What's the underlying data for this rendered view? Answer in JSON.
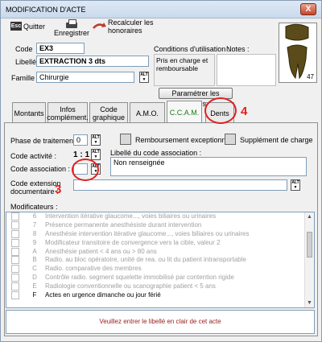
{
  "window": {
    "title": "MODIFICATION D'ACTE",
    "close_glyph": "X"
  },
  "toolbar": {
    "quit_label": "Quitter",
    "quit_icon_text": "Esc",
    "save_label": "Enregistrer",
    "recalc_label": "Recalculer les honoraires"
  },
  "form": {
    "code_label": "Code",
    "code_value": "EX3",
    "libelle_label": "Libellé",
    "libelle_value": "EXTRACTION 3 dts",
    "famille_label": "Famille",
    "famille_value": "Chirurgie",
    "conditions_label": "Conditions d'utilisation :",
    "notes_label": "Notes :",
    "conditions_value": "Pris en charge et remboursable",
    "parametrer_label": "Paramétrer les Familles...",
    "tooth_number": "47"
  },
  "tabs": [
    {
      "label": "Montants"
    },
    {
      "label": "Infos complément."
    },
    {
      "label": "Code graphique"
    },
    {
      "label": "A.M.O."
    },
    {
      "label": "C.C.A.M."
    },
    {
      "label": "Dents"
    }
  ],
  "ccam": {
    "phase_label": "Phase de traitement :",
    "phase_value": "0",
    "remb_label": "Remboursement exceptionnel",
    "supp_label": "Supplément de charge",
    "code_activite_label": "Code activité :",
    "code_activite_value": "1 : 1",
    "code_association_label": "Code association :",
    "libelle_assoc_label": "Libellé du code association :",
    "libelle_assoc_value": "Non renseignée",
    "code_extension_label": "Code extension documentaire :",
    "modificateurs_label": "Modificateurs :",
    "alt_text": "ALT"
  },
  "modificateurs": [
    {
      "code": "6",
      "desc": "Intervention itérative glaucome..., voies biliaires ou urinaires",
      "active": false
    },
    {
      "code": "7",
      "desc": "Présence permanente anesthésiste durant intervention",
      "active": false
    },
    {
      "code": "8",
      "desc": "Anesthésie intervention itérative glaucome..., voies biliaires ou urinaires",
      "active": false
    },
    {
      "code": "9",
      "desc": "Modificateur transitoire de convergence vers la cible, valeur 2",
      "active": false
    },
    {
      "code": "A",
      "desc": "Anesthésie patient < 4 ans ou > 80 ans",
      "active": false
    },
    {
      "code": "B",
      "desc": "Radio. au bloc opératoire, unité de rea. ou lit du patient intransportable",
      "active": false
    },
    {
      "code": "C",
      "desc": "Radio. comparative des membres",
      "active": false
    },
    {
      "code": "D",
      "desc": "Contrôle radio. segment squelette immobilisé par contention rigide",
      "active": false
    },
    {
      "code": "E",
      "desc": "Radiologie conventionnelle ou scanographie patient < 5 ans",
      "active": false
    },
    {
      "code": "F",
      "desc": "Actes en urgence dimanche ou jour férié",
      "active": true
    }
  ],
  "status_message": "Veuillez entrer le libellé en clair de cet acte",
  "annotations": {
    "dents_marker": "4",
    "association_marker": "3"
  },
  "colors": {
    "annotation_red": "#e02020",
    "status_text": "#9c1b1b",
    "ccam_tab_text": "#1a7a1a"
  }
}
